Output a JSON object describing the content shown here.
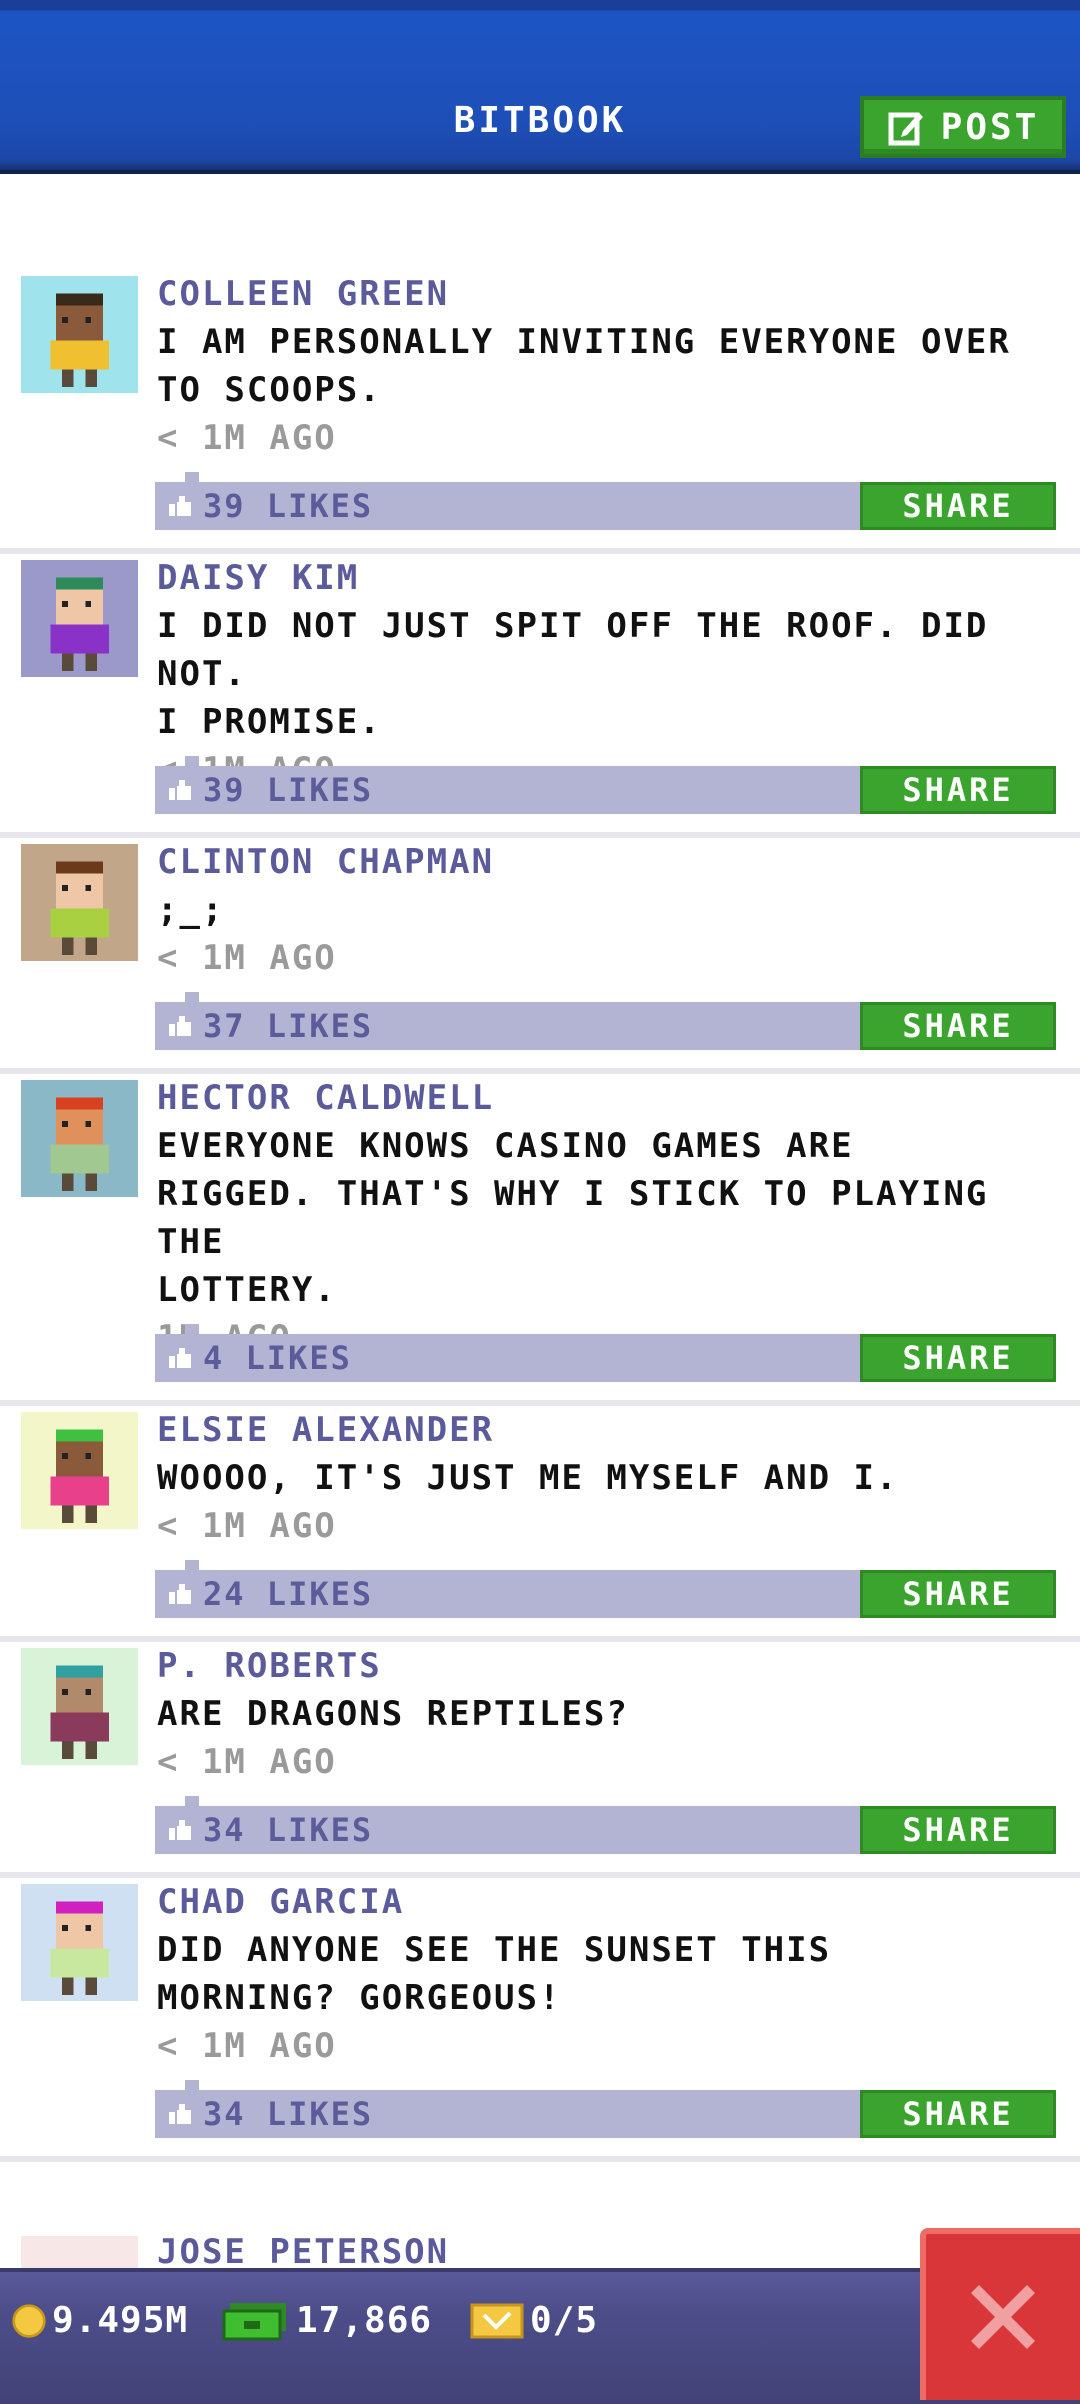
{
  "header": {
    "title": "BITBOOK",
    "post_label": "POST"
  },
  "posts": [
    {
      "name": "COLLEEN GREEN",
      "lines": [
        "I AM PERSONALLY INVITING EVERYONE OVER",
        "TO SCOOPS."
      ],
      "time": "< 1M AGO",
      "likes": "39 LIKES",
      "share": "SHARE",
      "avatar_bg": "#9fe3ec",
      "skin": "#8a5a3a",
      "hair": "#3a2a1a",
      "shirt": "#f0c030"
    },
    {
      "name": "DAISY KIM",
      "lines": [
        "I DID NOT JUST SPIT OFF THE ROOF. DID NOT.",
        "I PROMISE."
      ],
      "time": "< 1M AGO",
      "likes": "39 LIKES",
      "share": "SHARE",
      "avatar_bg": "#9a99c9",
      "skin": "#efc6a6",
      "hair": "#2f8a5a",
      "shirt": "#8a32c8"
    },
    {
      "name": "CLINTON CHAPMAN",
      "lines": [
        ";_;"
      ],
      "time": "< 1M AGO",
      "likes": "37 LIKES",
      "share": "SHARE",
      "avatar_bg": "#c2a68a",
      "skin": "#efc6a6",
      "hair": "#6a3a1a",
      "shirt": "#a8d040"
    },
    {
      "name": "HECTOR CALDWELL",
      "lines": [
        "EVERYONE KNOWS CASINO GAMES ARE",
        "RIGGED. THAT'S WHY I STICK TO PLAYING THE",
        "LOTTERY."
      ],
      "time": "1M AGO",
      "likes": "4 LIKES",
      "share": "SHARE",
      "avatar_bg": "#8ab8c6",
      "skin": "#e0905a",
      "hair": "#d84020",
      "shirt": "#a0c890"
    },
    {
      "name": "ELSIE ALEXANDER",
      "lines": [
        "WOOOO, IT'S JUST ME MYSELF AND I."
      ],
      "time": "< 1M AGO",
      "likes": "24 LIKES",
      "share": "SHARE",
      "avatar_bg": "#f3f6c9",
      "skin": "#8a5a3a",
      "hair": "#40c040",
      "shirt": "#e8408a"
    },
    {
      "name": "P. ROBERTS",
      "lines": [
        "ARE DRAGONS REPTILES?"
      ],
      "time": "< 1M AGO",
      "likes": "34 LIKES",
      "share": "SHARE",
      "avatar_bg": "#d9f3d9",
      "skin": "#b08a6a",
      "hair": "#30a0a0",
      "shirt": "#8a3a5a"
    },
    {
      "name": "CHAD GARCIA",
      "lines": [
        "DID ANYONE SEE THE SUNSET THIS",
        "MORNING? GORGEOUS!"
      ],
      "time": "< 1M AGO",
      "likes": "34 LIKES",
      "share": "SHARE",
      "avatar_bg": "#cfe0f3",
      "skin": "#efc6a6",
      "hair": "#d020c0",
      "shirt": "#c8e8a0"
    }
  ],
  "partial_post": {
    "name": "JOSE PETERSON"
  },
  "footer": {
    "coins": "9.495M",
    "cash": "17,866",
    "tickets": "0/5"
  },
  "colors": {
    "header_blue": "#1e4fb8",
    "accent_green": "#3aa42e",
    "like_bar": "#b3b3d3",
    "name_purple": "#5b5a9a",
    "close_red": "#d9363a"
  },
  "icons": {
    "post": "edit-icon",
    "like": "thumbs-up-icon",
    "coins": "coin-icon",
    "cash": "cash-icon",
    "tickets": "ticket-icon",
    "close": "close-icon"
  }
}
